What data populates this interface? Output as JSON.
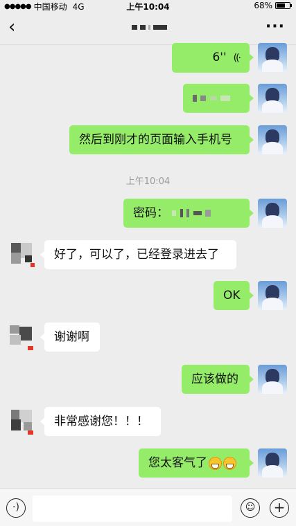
{
  "status_bar": {
    "signal_dots": "●●●●●",
    "carrier": "中国移动",
    "network": "4G",
    "time": "上午10:04",
    "battery_percent": "68%",
    "battery_level": 0.68
  },
  "nav": {
    "back_icon": "chevron-left-icon",
    "more_label": "···"
  },
  "messages": [
    {
      "side": "me",
      "type": "voice",
      "text": "6''",
      "wave_icon": "voice-wave-icon"
    },
    {
      "side": "me",
      "type": "redacted"
    },
    {
      "side": "me",
      "text": "然后到刚才的页面输入手机号"
    },
    {
      "side": "timestamp",
      "text": "上午10:04"
    },
    {
      "side": "me",
      "text": "密码："
    },
    {
      "side": "other",
      "text": "好了，可以了，已经登录进去了"
    },
    {
      "side": "me",
      "text": "OK"
    },
    {
      "side": "other",
      "text": "谢谢啊"
    },
    {
      "side": "me",
      "text": "应该做的"
    },
    {
      "side": "other",
      "text": "非常感谢您！！！"
    },
    {
      "side": "me",
      "text": "您太客气了"
    }
  ],
  "bottom_bar": {
    "voice_icon": "voice-input-icon",
    "emoji_icon": "emoji-icon",
    "plus_icon": "plus-icon"
  }
}
